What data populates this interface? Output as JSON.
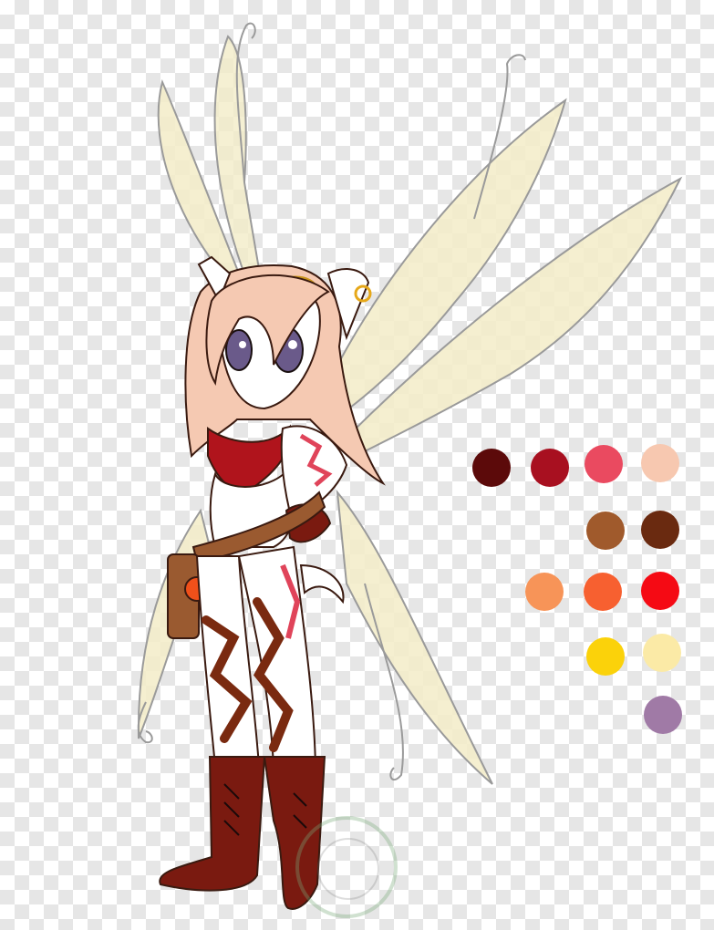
{
  "image": {
    "subject": "fairy-character-reference-sheet"
  },
  "palette": {
    "swatches": [
      {
        "color": "#5c0a0a"
      },
      {
        "color": "#a81020"
      },
      {
        "color": "#ea4a60"
      },
      {
        "color": "#f7c8b0"
      },
      {
        "color": "#a05a2c"
      },
      {
        "color": "#6a2a10"
      },
      {
        "color": "#f79458"
      },
      {
        "color": "#f76030"
      },
      {
        "color": "#f50a14"
      },
      {
        "color": "#fbd20a"
      },
      {
        "color": "#fbeaa6"
      },
      {
        "color": "#a07aa6"
      }
    ]
  },
  "colors": {
    "wings": "#f3ecc8",
    "wing_outline": "#9a9a9a",
    "hair": "#f5c9b2",
    "fur_white": "#ffffff",
    "pants": "#7a2a10",
    "boots": "#7a1a10",
    "scarf": "#b0141c",
    "belt": "#9a5a30",
    "markings": "#e0445a",
    "eyes": "#6a5a8a"
  }
}
